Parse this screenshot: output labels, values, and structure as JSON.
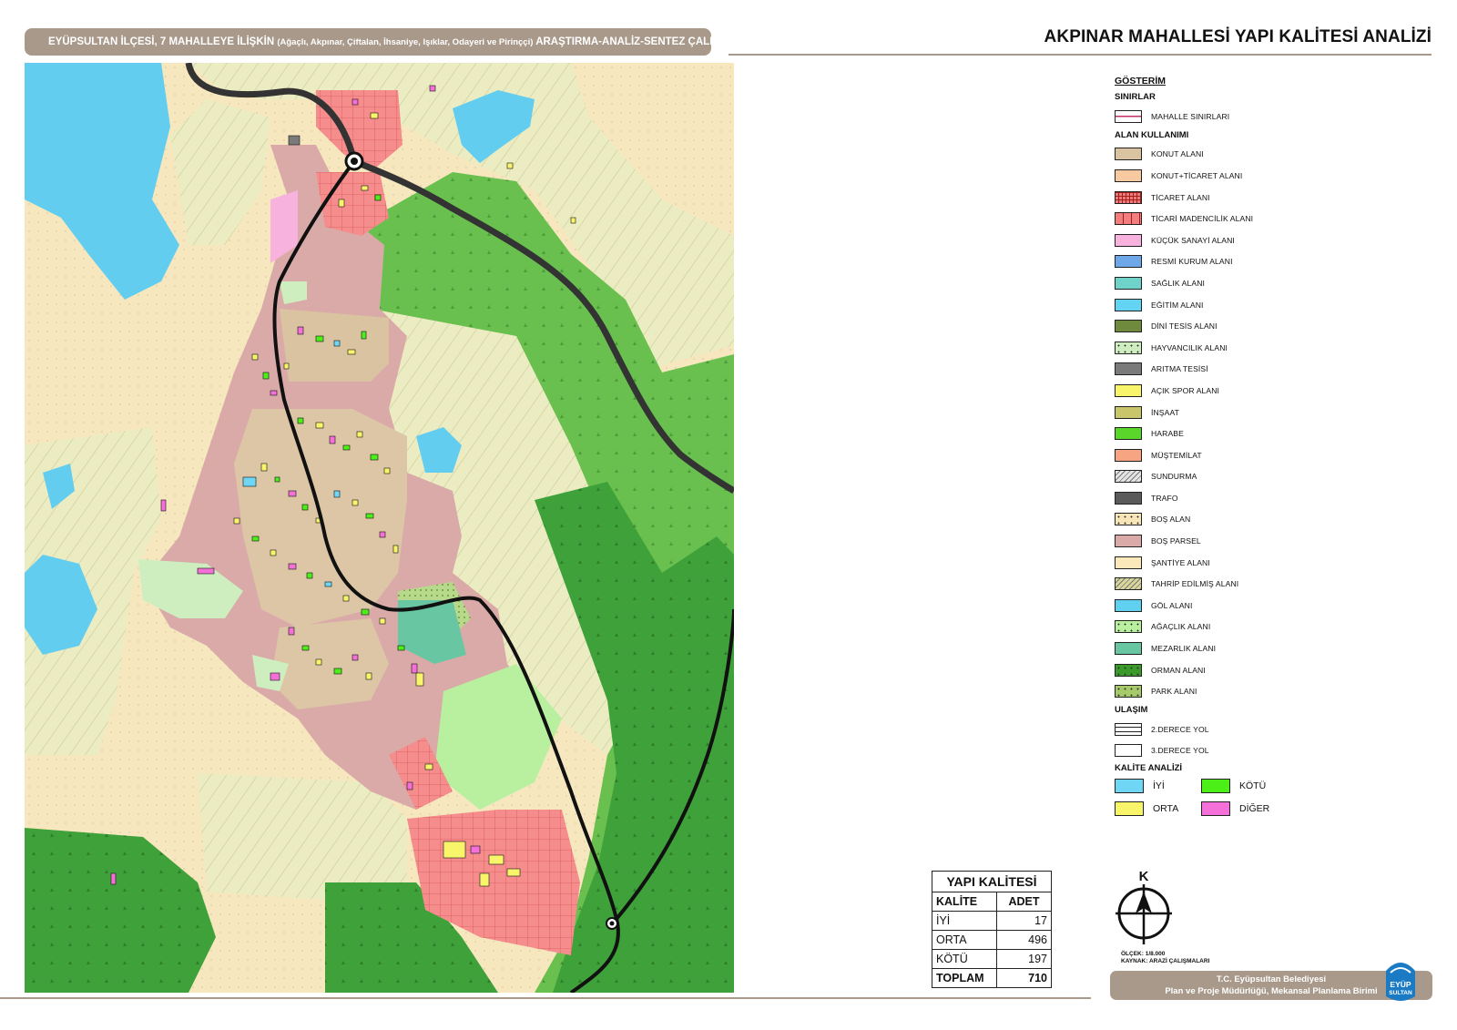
{
  "header": {
    "banner_main": "EYÜPSULTAN İLÇESİ, 7 MAHALLEYE İLİŞKİN",
    "banner_sub": "(Ağaçlı, Akpınar, Çiftalan, İhsaniye, Işıklar, Odayeri ve Pirinççi)",
    "banner_end": "ARAŞTIRMA-ANALİZ-SENTEZ ÇALIŞMALARI",
    "title": "AKPINAR MAHALLESİ YAPI KALİTESİ ANALİZİ"
  },
  "legend": {
    "heading": "GÖSTERİM",
    "sections": [
      {
        "title": "SINIRLAR",
        "items": [
          {
            "label": "MAHALLE SINIRLARI",
            "color": "#ffffff",
            "icon": "boundary-line"
          }
        ]
      },
      {
        "title": "ALAN KULLANIMI",
        "items": [
          {
            "label": "KONUT ALANI",
            "color": "#d9c3a0",
            "icon": "solid"
          },
          {
            "label": "KONUT+TİCARET ALANI",
            "color": "#f7c9a0",
            "icon": "solid"
          },
          {
            "label": "TİCARET ALANI",
            "color": "#f07a7a",
            "icon": "grid"
          },
          {
            "label": "TİCARİ MADENCİLİK ALANI",
            "color": "#f47e7e",
            "icon": "vline"
          },
          {
            "label": "KÜÇÜK SANAYİ ALANI",
            "color": "#f7b3dd",
            "icon": "solid"
          },
          {
            "label": "RESMİ KURUM ALANI",
            "color": "#6fa8e8",
            "icon": "solid"
          },
          {
            "label": "SAĞLIK ALANI",
            "color": "#6fd3c9",
            "icon": "solid"
          },
          {
            "label": "EĞİTİM ALANI",
            "color": "#62d3f2",
            "icon": "solid"
          },
          {
            "label": "DİNİ TESİS ALANI",
            "color": "#6f8a3c",
            "icon": "solid"
          },
          {
            "label": "HAYVANCILIK ALANI",
            "color": "#cfeec0",
            "icon": "dots"
          },
          {
            "label": "ARITMA TESİSİ",
            "color": "#7a7a7a",
            "icon": "solid"
          },
          {
            "label": "AÇIK SPOR ALANI",
            "color": "#f8f56a",
            "icon": "solid"
          },
          {
            "label": "İNŞAAT",
            "color": "#c9c56a",
            "icon": "solid"
          },
          {
            "label": "HARABE",
            "color": "#5ad62a",
            "icon": "solid"
          },
          {
            "label": "MÜŞTEMİLAT",
            "color": "#f6a482",
            "icon": "solid"
          },
          {
            "label": "SUNDURMA",
            "color": "#e4e4e4",
            "icon": "hatch"
          },
          {
            "label": "TRAFO",
            "color": "#5a5a5a",
            "icon": "solid"
          },
          {
            "label": "BOŞ ALAN",
            "color": "#f8e5b8",
            "icon": "dots"
          },
          {
            "label": "BOŞ PARSEL",
            "color": "#d9aaa8",
            "icon": "solid"
          },
          {
            "label": "ŞANTİYE ALANI",
            "color": "#fbe9bb",
            "icon": "solid"
          },
          {
            "label": "TAHRİP EDİLMİŞ ALANI",
            "color": "#d8d69a",
            "icon": "hatch"
          },
          {
            "label": "GÖL ALANI",
            "color": "#5fd0f0",
            "icon": "solid"
          },
          {
            "label": "AĞAÇLIK ALANI",
            "color": "#b8f0a0",
            "icon": "dots"
          },
          {
            "label": "MEZARLIK ALANI",
            "color": "#68c6a2",
            "icon": "solid"
          },
          {
            "label": "ORMAN ALANI",
            "color": "#3a9a2a",
            "icon": "dots"
          },
          {
            "label": "PARK ALANI",
            "color": "#a6c96a",
            "icon": "dots"
          }
        ]
      },
      {
        "title": "ULAŞIM",
        "items": [
          {
            "label": "2.DERECE YOL",
            "color": "#ffffff",
            "icon": "road2"
          },
          {
            "label": "3.DERECE YOL",
            "color": "#ffffff",
            "icon": "road3"
          }
        ]
      }
    ],
    "quality_title": "KALİTE ANALİZİ",
    "quality_items": [
      {
        "label": "İYİ",
        "color": "#6fd6f5"
      },
      {
        "label": "KÖTÜ",
        "color": "#4cf018"
      },
      {
        "label": "ORTA",
        "color": "#f8f56a"
      },
      {
        "label": "DİĞER",
        "color": "#f470d8"
      }
    ]
  },
  "table": {
    "caption": "YAPI KALİTESİ",
    "headers": [
      "KALİTE",
      "ADET"
    ],
    "rows": [
      {
        "label": "İYİ",
        "value": "17"
      },
      {
        "label": "ORTA",
        "value": "496"
      },
      {
        "label": "KÖTÜ",
        "value": "197"
      },
      {
        "label": "TOPLAM",
        "value": "710"
      }
    ]
  },
  "north": {
    "letter": "K"
  },
  "scale": {
    "line1": "ÖLÇEK: 1/8.000",
    "line2": "KAYNAK: ARAZİ ÇALIŞMALARI"
  },
  "footer": {
    "line1": "T.C. Eyüpsultan Belediyesi",
    "line2": "Plan ve Proje Müdürlüğü, Mekansal Planlama Birimi"
  },
  "logo": {
    "text1": "EYÜP",
    "text2": "SULTAN",
    "color": "#1a7ac4"
  }
}
